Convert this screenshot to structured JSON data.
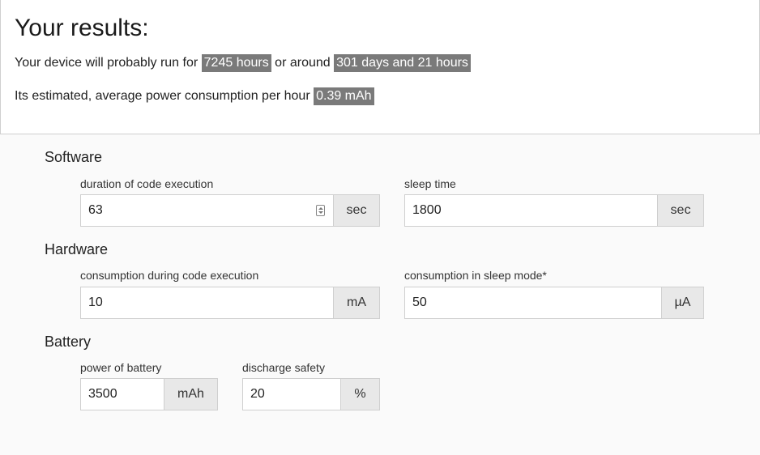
{
  "results": {
    "title": "Your results:",
    "runtime_prefix": "Your device will probably run for",
    "runtime_hours": "7245 hours",
    "runtime_middle": "or around",
    "runtime_days": "301 days and 21 hours",
    "consumption_prefix": "Its estimated, average power consumption per hour",
    "consumption_value": "0.39 mAh"
  },
  "software": {
    "title": "Software",
    "duration": {
      "label": "duration of code execution",
      "value": "63",
      "unit": "sec"
    },
    "sleep": {
      "label": "sleep time",
      "value": "1800",
      "unit": "sec"
    }
  },
  "hardware": {
    "title": "Hardware",
    "exec_consumption": {
      "label": "consumption during code execution",
      "value": "10",
      "unit": "mA"
    },
    "sleep_consumption": {
      "label": "consumption in sleep mode*",
      "value": "50",
      "unit": "µA"
    }
  },
  "battery": {
    "title": "Battery",
    "power": {
      "label": "power of battery",
      "value": "3500",
      "unit": "mAh"
    },
    "safety": {
      "label": "discharge safety",
      "value": "20",
      "unit": "%"
    }
  }
}
